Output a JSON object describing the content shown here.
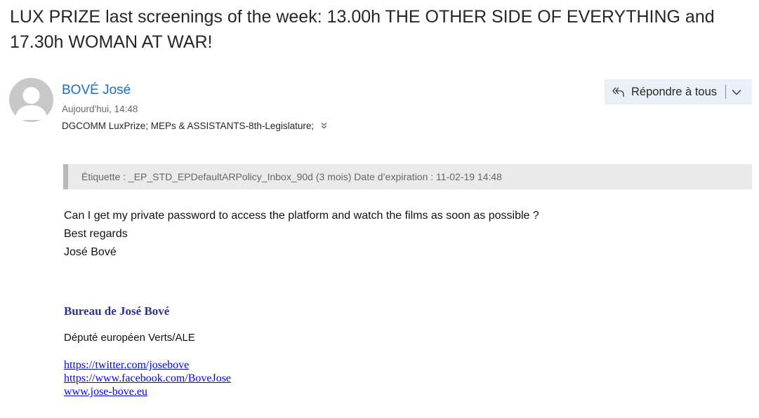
{
  "email": {
    "subject": "LUX PRIZE last screenings of the week: 13.00h THE OTHER SIDE OF EVERYTHING and 17.30h WOMAN AT WAR!",
    "sender": {
      "name": "BOVÉ José",
      "time": "Aujourd'hui, 14:48",
      "recipients_prefix": "DGCOMM LuxPrize; ",
      "recipients_main": "MEPs & ASSISTANTS-8th-Legislature;",
      "expand_icon": "double-chevron-down-icon"
    },
    "reply": {
      "label": "Répondre à tous",
      "icon": "reply-all-icon",
      "dropdown_icon": "chevron-down-icon"
    },
    "retention_label": "Étiquette : _EP_STD_EPDefaultARPolicy_Inbox_90d (3 mois) Date d’expiration : 11-02-19 14:48",
    "body_lines": [
      "Can I get my private password to access the platform and watch the films as soon as possible ?",
      "Best regards",
      "José Bové"
    ],
    "signature": {
      "title": "Bureau de José Bové",
      "role": "Député européen Verts/ALE",
      "links": [
        "https://twitter.com/josebove",
        "https://www.facebook.com/BoveJose",
        "www.jose-bove.eu"
      ]
    }
  },
  "colors": {
    "sender_link": "#1b6ec2",
    "reply_bg": "#eaf0f7",
    "label_bg": "#eaeaea",
    "signature_title": "#2e3192",
    "hyperlink": "#0000ee"
  }
}
